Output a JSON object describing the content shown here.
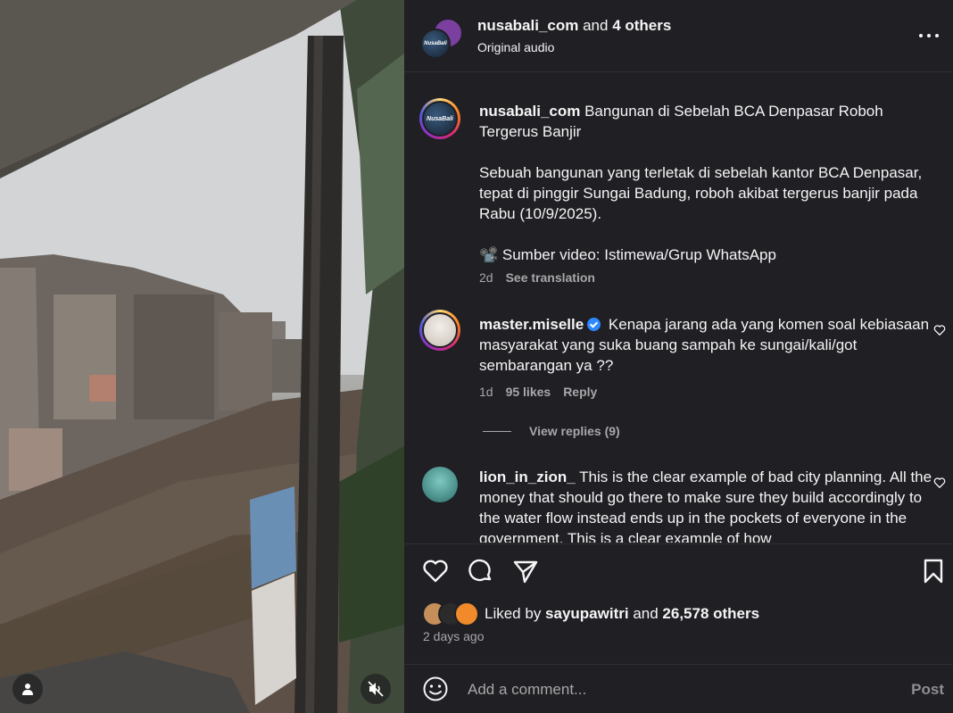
{
  "header": {
    "username": "nusabali_com",
    "and_text": " and ",
    "others": "4 others",
    "audio": "Original audio",
    "avatar_text": "NusaBali"
  },
  "caption": {
    "username": "nusabali_com",
    "title": " Bangunan di Sebelah BCA Denpasar Roboh Tergerus Banjir",
    "body": "Sebuah bangunan yang terletak di sebelah kantor BCA Denpasar, tepat di pinggir Sungai Badung, roboh akibat tergerus banjir pada Rabu (10/9/2025).",
    "source": "📽️ Sumber video: Istimewa/Grup WhatsApp",
    "time": "2d",
    "see_translation": "See translation"
  },
  "comments": [
    {
      "username": "master.miselle",
      "verified": true,
      "text": " Kenapa jarang ada yang komen soal kebiasaan masyarakat yang suka buang sampah ke sungai/kali/got sembarangan ya ??",
      "time": "1d",
      "likes": "95 likes",
      "reply": "Reply",
      "view_replies": "View replies (9)"
    },
    {
      "username": "lion_in_zion_",
      "verified": false,
      "text": " This is the clear example of bad city planning. All the money that should go there to make sure they build accordingly to the water flow instead ends up in the pockets of everyone in the government. This is a clear example of how"
    }
  ],
  "likes": {
    "prefix": "Liked by ",
    "user": "sayupawitri",
    "middle": " and ",
    "count": "26,578 others",
    "time": "2 days ago"
  },
  "add_comment": {
    "placeholder": "Add a comment...",
    "post_label": "Post"
  },
  "icons": {
    "more": "more-options-icon",
    "like": "heart-icon",
    "comment": "comment-icon",
    "share": "share-icon",
    "save": "bookmark-icon",
    "emoji": "emoji-icon",
    "user_tag": "user-icon",
    "mute": "muted-speaker-icon"
  },
  "colors": {
    "panel_bg": "#1f1f24",
    "primary_text": "#f5f5f5",
    "secondary_text": "#a8a8a8",
    "verified": "#2d88ff"
  }
}
